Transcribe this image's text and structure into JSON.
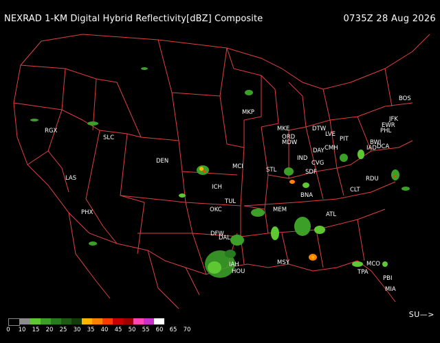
{
  "header": {
    "title": "NEXRAD 1-KM Digital Hybrid Reflectivity[dBZ] Composite",
    "timestamp": "0735Z 28 Aug 2026"
  },
  "map": {
    "boundary_color": "#e04040",
    "background_color": "#000000",
    "city_label_color": "#ffffff",
    "cities": [
      "RGX",
      "SLC",
      "LAS",
      "PHX",
      "DEN",
      "ICH",
      "MCI",
      "OKC",
      "TUL",
      "DFW",
      "DAL",
      "IAH",
      "HOU",
      "MKE",
      "MKP",
      "ORD",
      "MDW",
      "DTW",
      "LVE",
      "PIT",
      "BOS",
      "JFK",
      "EWR",
      "PHL",
      "BWI",
      "IAD",
      "DCA",
      "IND",
      "DAY",
      "CMH",
      "CVG",
      "SDF",
      "STL",
      "BNA",
      "MEM",
      "ATL",
      "CLT",
      "RDU",
      "MSY",
      "MCO",
      "TPA",
      "PBI",
      "MIA"
    ]
  },
  "legend": {
    "colors": [
      "#000000",
      "#8c8c8c",
      "#5ec832",
      "#3c9f28",
      "#287a1e",
      "#1e5a14",
      "#143c0a",
      "#ffb400",
      "#ff8200",
      "#ff3c00",
      "#c80000",
      "#a00000",
      "#ff46b4",
      "#c832c8",
      "#ffffff"
    ],
    "labels": [
      "0",
      "10",
      "15",
      "20",
      "25",
      "30",
      "35",
      "40",
      "45",
      "50",
      "55",
      "60",
      "65",
      "70"
    ],
    "nav_label": "SU—>"
  }
}
